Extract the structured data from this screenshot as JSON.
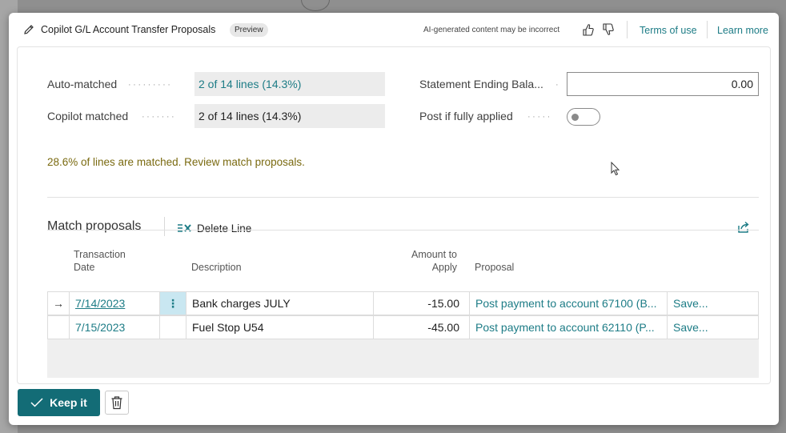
{
  "dialog": {
    "title": "Copilot G/L Account Transfer Proposals",
    "badge": "Preview",
    "disclaimer": "AI-generated content may be incorrect",
    "terms_link": "Terms of use",
    "learn_link": "Learn more",
    "icons": [
      "pencil-icon",
      "thumbs-up-icon",
      "thumbs-down-icon"
    ]
  },
  "summary": {
    "auto_matched_label": "Auto-matched",
    "auto_matched_value": "2 of 14 lines (14.3%)",
    "copilot_matched_label": "Copilot matched",
    "copilot_matched_value": "2 of 14 lines (14.3%)",
    "statement_label": "Statement Ending Bala...",
    "statement_value": "0.00",
    "post_label": "Post if fully applied",
    "post_toggle_on": false,
    "message": "28.6% of lines are matched. Review match proposals."
  },
  "proposals": {
    "title": "Match proposals",
    "delete_label": "Delete Line",
    "columns": {
      "date_l1": "Transaction",
      "date_l2": "Date",
      "description": "Description",
      "amount_l1": "Amount to",
      "amount_l2": "Apply",
      "proposal": "Proposal"
    },
    "rows": [
      {
        "arrow": "→",
        "date": "7/14/2023",
        "menu": "⋮",
        "description": "Bank charges JULY",
        "amount": "-15.00",
        "proposal": "Post payment to account 67100 (B...",
        "save": "Save..."
      },
      {
        "arrow": "",
        "date": "7/15/2023",
        "menu": "",
        "description": "Fuel Stop U54",
        "amount": "-45.00",
        "proposal": "Post payment to account 62110 (P...",
        "save": "Save..."
      }
    ]
  },
  "footer": {
    "keep_label": "Keep it"
  },
  "colors": {
    "accent": "#1d7c86",
    "primary_button": "#136c76",
    "message": "#7a6a10"
  }
}
